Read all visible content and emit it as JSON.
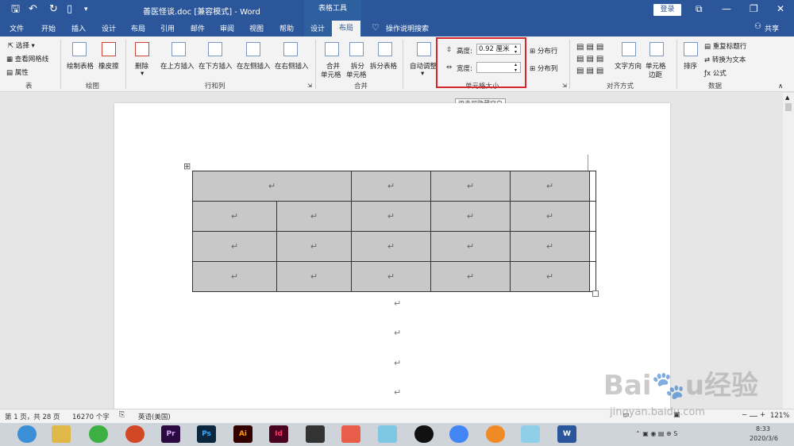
{
  "titlebar": {
    "title": "善医怪谈.doc [兼容模式] - Word",
    "context_tab": "表格工具",
    "login": "登录",
    "share": "共享"
  },
  "tabs": {
    "file": "文件",
    "home": "开始",
    "insert": "插入",
    "design": "设计",
    "layout_page": "布局",
    "references": "引用",
    "mailings": "邮件",
    "review": "审阅",
    "view": "视图",
    "help": "帮助",
    "table_design": "设计",
    "table_layout": "布局",
    "tell_me": "操作说明搜索"
  },
  "ribbon": {
    "select": "选择",
    "view_gridlines": "查看网格线",
    "properties": "属性",
    "group_table": "表",
    "draw_table": "绘制表格",
    "eraser": "橡皮擦",
    "group_draw": "绘图",
    "delete": "删除",
    "insert_above": "在上方插入",
    "insert_below": "在下方插入",
    "insert_left": "在左侧插入",
    "insert_right": "在右侧插入",
    "group_rows_cols": "行和列",
    "merge_cells_l1": "合并",
    "merge_cells_l2": "单元格",
    "split_cells_l1": "拆分",
    "split_cells_l2": "单元格",
    "split_table": "拆分表格",
    "group_merge": "合并",
    "autofit": "自动调整",
    "height_label": "高度:",
    "height_value": "0.92 厘米",
    "width_label": "宽度:",
    "width_value": "",
    "group_cell_size": "单元格大小",
    "distribute_rows": "分布行",
    "distribute_cols": "分布列",
    "text_direction": "文字方向",
    "cell_margins_l1": "单元格",
    "cell_margins_l2": "边距",
    "group_alignment": "对齐方式",
    "sort": "排序",
    "repeat_header": "重复标题行",
    "convert_to_text": "转换为文本",
    "formula": "公式",
    "group_data": "数据"
  },
  "tooltip": "双击可隐藏空白",
  "document": {
    "paragraph_mark": "↵",
    "table_rows": [
      [
        "↵",
        "↵",
        "↵",
        "↵",
        "↵"
      ],
      [
        "↵",
        "↵",
        "↵",
        "↵",
        "↵",
        "↵"
      ],
      [
        "↵",
        "↵",
        "↵",
        "↵",
        "↵",
        "↵"
      ],
      [
        "↵",
        "↵",
        "↵",
        "↵",
        "↵",
        "↵"
      ]
    ]
  },
  "statusbar": {
    "page": "第 1 页，共 28 页",
    "words": "16270 个字",
    "language": "英语(美国)",
    "zoom": "121%"
  },
  "taskbar": {
    "time": "8:33",
    "date": "2020/3/6",
    "apps": [
      "Pr",
      "Ps",
      "Ai",
      "Id",
      "W"
    ]
  },
  "watermark": {
    "logo": "Baidu经验",
    "url": "jingyan.baidu.com"
  }
}
